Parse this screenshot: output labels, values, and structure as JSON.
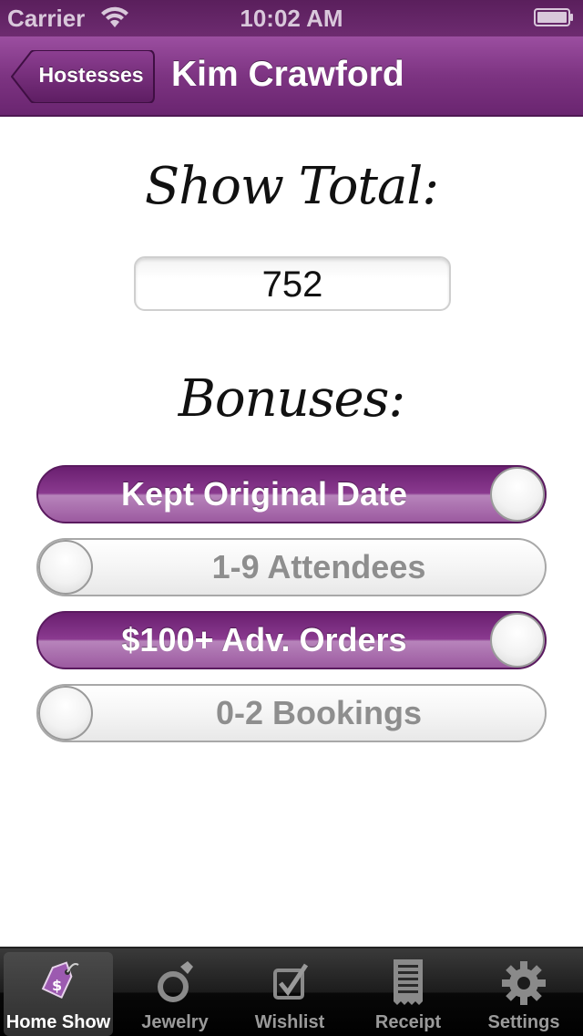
{
  "status_bar": {
    "carrier": "Carrier",
    "time": "10:02 AM"
  },
  "nav": {
    "back_label": "Hostesses",
    "title": "Kim Crawford"
  },
  "show_total": {
    "heading": "Show Total:",
    "value": "752"
  },
  "bonuses": {
    "heading": "Bonuses:",
    "items": [
      {
        "label": "Kept Original Date",
        "on": true
      },
      {
        "label": "1-9 Attendees",
        "on": false
      },
      {
        "label": "$100+ Adv. Orders",
        "on": true
      },
      {
        "label": "0-2 Bookings",
        "on": false
      }
    ]
  },
  "tab_bar": {
    "tabs": [
      {
        "label": "Home Show",
        "icon": "price-tag-icon",
        "active": true
      },
      {
        "label": "Jewelry",
        "icon": "ring-icon",
        "active": false
      },
      {
        "label": "Wishlist",
        "icon": "checkbox-icon",
        "active": false
      },
      {
        "label": "Receipt",
        "icon": "receipt-icon",
        "active": false
      },
      {
        "label": "Settings",
        "icon": "gear-icon",
        "active": false
      }
    ]
  },
  "colors": {
    "brand_purple": "#7d3482",
    "toggle_on": "#8a3a8f",
    "tab_bar": "#1c1c1c"
  }
}
